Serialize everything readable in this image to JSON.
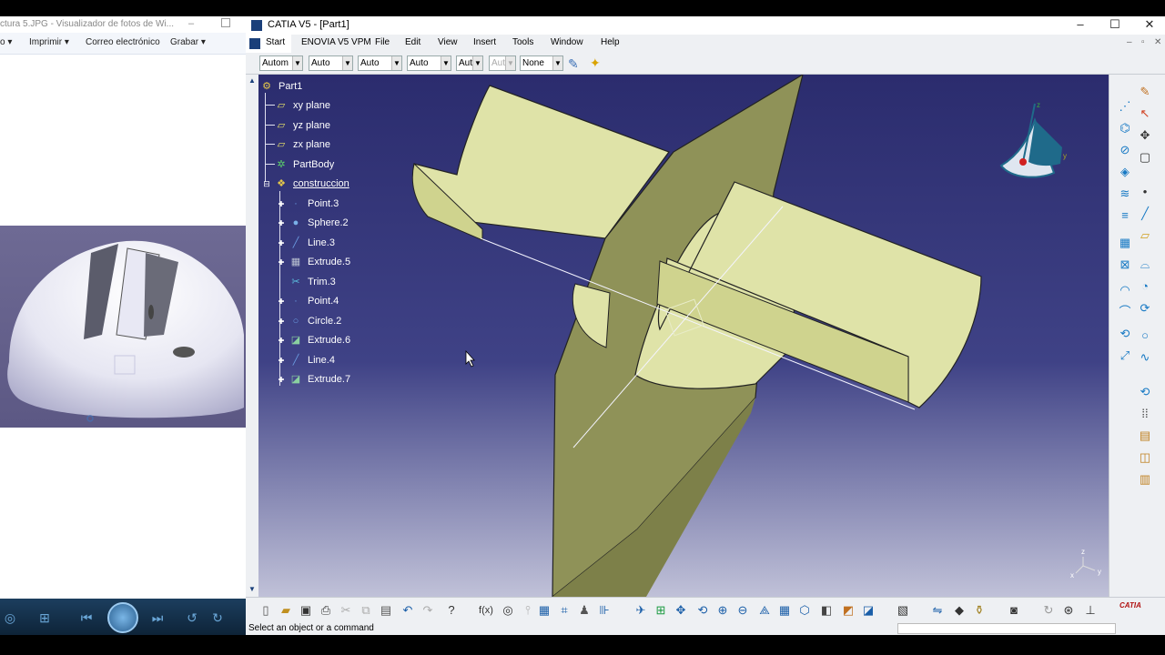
{
  "viewer": {
    "title": "ctura 5.JPG - Visualizador de fotos de Wi...",
    "menu": [
      "o ▾",
      "Imprimir ▾",
      "Correo electrónico",
      "Grabar ▾"
    ]
  },
  "catia": {
    "title": "CATIA V5 - [Part1]",
    "menu": [
      "Start",
      "ENOVIA V5 VPM",
      "File",
      "Edit",
      "View",
      "Insert",
      "Tools",
      "Window",
      "Help"
    ],
    "combos": [
      "Autom",
      "Auto",
      "Auto",
      "Auto",
      "Aut",
      "Aut",
      "None"
    ],
    "tree": {
      "root": "Part1",
      "planes": [
        "xy plane",
        "yz plane",
        "zx plane"
      ],
      "body": "PartBody",
      "set": "construccion",
      "features": [
        "Point.3",
        "Sphere.2",
        "Line.3",
        "Extrude.5",
        "Trim.3",
        "Point.4",
        "Circle.2",
        "Extrude.6",
        "Line.4",
        "Extrude.7"
      ]
    },
    "status": "Select an object or a command",
    "compass_labels": [
      "z",
      "y"
    ],
    "axis_labels": [
      "z",
      "y",
      "x"
    ],
    "logo": "CATIA"
  },
  "colors": {
    "viewport_top": "#2b2c6e",
    "viewport_bottom": "#c0c1d8",
    "surface": "#dfe3a8",
    "plane": "#8f9258",
    "compass": "#1f6a8a"
  }
}
